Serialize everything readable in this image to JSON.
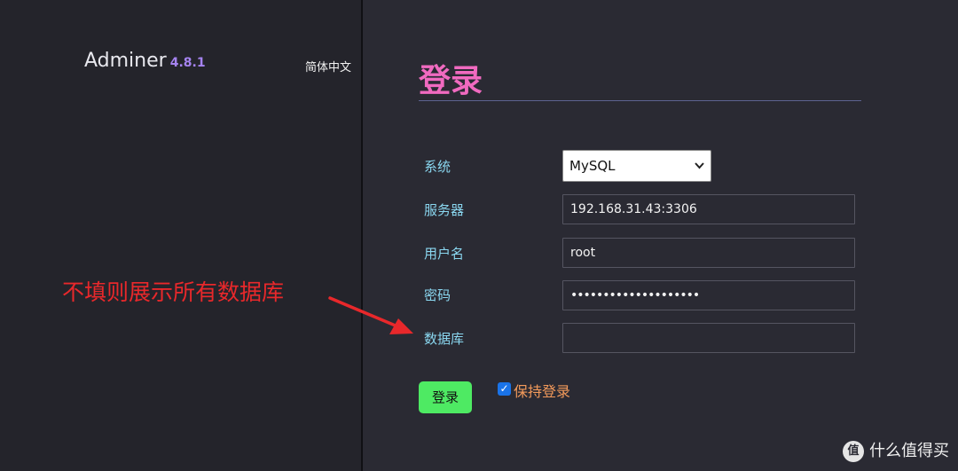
{
  "sidebar": {
    "app_name": "Adminer",
    "version": "4.8.1",
    "language": "简体中文"
  },
  "annotation": "不填则展示所有数据库",
  "form": {
    "title": "登录",
    "system_label": "系统",
    "system_value": "MySQL",
    "server_label": "服务器",
    "server_value": "192.168.31.43:3306",
    "username_label": "用户名",
    "username_value": "root",
    "password_label": "密码",
    "password_value": "••••••••••••••••••••",
    "database_label": "数据库",
    "database_value": "",
    "login_button": "登录",
    "remember_checked": true,
    "remember_label": "保持登录"
  },
  "watermark": {
    "logo": "值",
    "text": "什么值得买"
  },
  "colors": {
    "title": "#f06ac0",
    "label": "#8ad7f0",
    "button": "#4eea63",
    "annotation": "#e8282b",
    "remember": "#f39a5b",
    "version": "#a583f0"
  }
}
